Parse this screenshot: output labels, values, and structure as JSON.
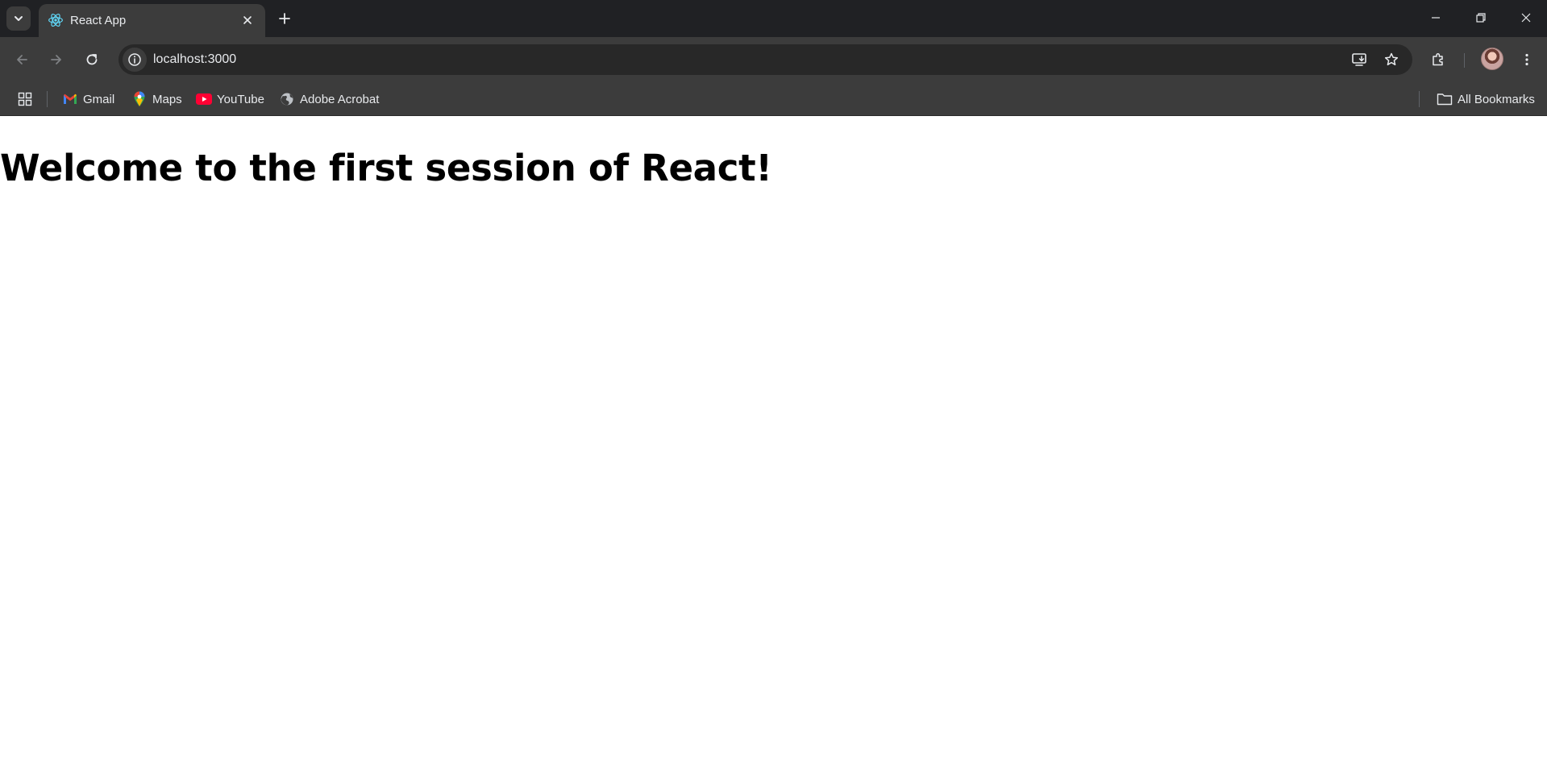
{
  "browser": {
    "tab": {
      "title": "React App",
      "favicon": "react-logo-icon"
    },
    "omnibox": {
      "url": "localhost:3000"
    },
    "bookmarks": [
      {
        "label": "Gmail",
        "icon": "gmail-icon"
      },
      {
        "label": "Maps",
        "icon": "maps-pin-icon"
      },
      {
        "label": "YouTube",
        "icon": "youtube-icon"
      },
      {
        "label": "Adobe Acrobat",
        "icon": "globe-icon"
      }
    ],
    "all_bookmarks_label": "All Bookmarks"
  },
  "page": {
    "heading": "Welcome to the first session of React!"
  },
  "colors": {
    "chrome_dark": "#202124",
    "chrome_toolbar": "#3c3c3c",
    "omnibox_bg": "#282828",
    "page_bg": "#ffffff",
    "react_blue": "#61dafb"
  }
}
